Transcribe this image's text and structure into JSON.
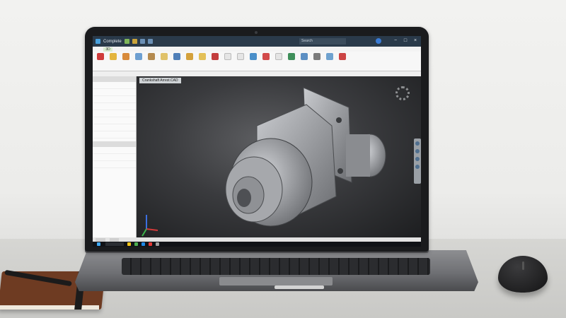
{
  "app": {
    "title": "Complete",
    "search_placeholder": "Search",
    "window_controls": [
      "−",
      "□",
      "×"
    ]
  },
  "ribbon": {
    "tabs": [
      "3D"
    ],
    "buttons": [],
    "groups": []
  },
  "browser": {
    "header_1": "",
    "items_1": [],
    "header_2": "",
    "items_2": []
  },
  "viewport": {
    "document_tab": "Crankshaft Arrest.CAD",
    "model_description": "3D mechanical flange/shaft part in gray shaded view"
  },
  "statusbar": {
    "tabs": []
  },
  "taskbar": {
    "search_label": "",
    "clock": ""
  },
  "colors": {
    "titlebar": "#2a3a4a",
    "accent_green": "#4caf50",
    "viewport_bg": "#3a3b3e",
    "model_gray": "#9a9ca0"
  }
}
